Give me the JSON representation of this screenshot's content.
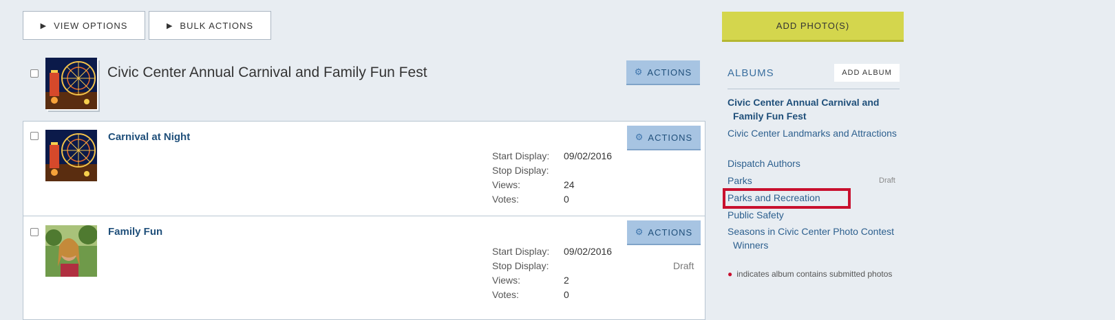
{
  "toolbar": {
    "view_options": "VIEW OPTIONS",
    "bulk_actions": "BULK ACTIONS",
    "add_photos": "ADD PHOTO(S)"
  },
  "album": {
    "title": "Civic Center Annual Carnival and Family Fun Fest",
    "actions_label": "ACTIONS"
  },
  "labels": {
    "start_display": "Start Display:",
    "stop_display": "Stop Display:",
    "views": "Views:",
    "votes": "Votes:"
  },
  "photos": [
    {
      "title": "Carnival at Night",
      "actions_label": "ACTIONS",
      "start_display": "09/02/2016",
      "stop_display": "",
      "views": "24",
      "votes": "0",
      "status": ""
    },
    {
      "title": "Family Fun",
      "actions_label": "ACTIONS",
      "start_display": "09/02/2016",
      "stop_display": "",
      "views": "2",
      "votes": "0",
      "status": "Draft"
    }
  ],
  "sidebar": {
    "albums_label": "ALBUMS",
    "add_album": "ADD ALBUM",
    "albums": [
      {
        "name": "Civic Center Annual Carnival and Family Fun Fest",
        "active": true
      },
      {
        "name": "Civic Center Landmarks and Attractions"
      },
      {
        "name": "Dispatch Authors"
      },
      {
        "name": "Parks",
        "status": "Draft"
      },
      {
        "name": "Parks and Recreation",
        "highlighted": true
      },
      {
        "name": "Public Safety"
      },
      {
        "name": "Seasons in Civic Center Photo Contest Winners"
      }
    ],
    "note": "indicates album contains submitted photos"
  },
  "icons": {
    "play_triangle": "▶",
    "gear": "⚙",
    "bullet": "●"
  },
  "colors": {
    "background": "#e8edf2",
    "add_photo_button": "#d4d64d",
    "actions_button": "#a7c4e2",
    "link": "#2c5f8e",
    "highlight": "#c8102e"
  }
}
